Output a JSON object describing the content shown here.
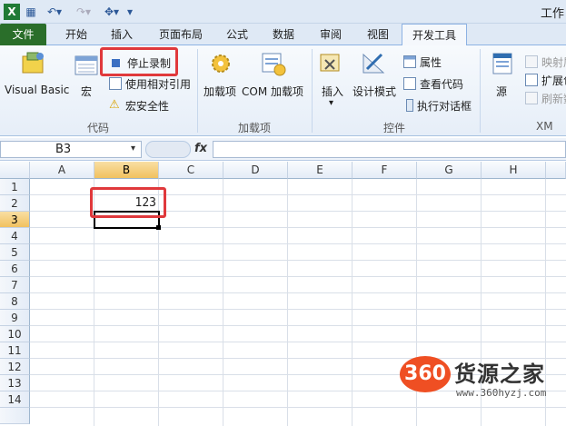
{
  "window": {
    "title": "工作"
  },
  "tabs": [
    {
      "label": "文件"
    },
    {
      "label": "开始"
    },
    {
      "label": "插入"
    },
    {
      "label": "页面布局"
    },
    {
      "label": "公式"
    },
    {
      "label": "数据"
    },
    {
      "label": "审阅"
    },
    {
      "label": "视图"
    },
    {
      "label": "开发工具"
    }
  ],
  "ribbon": {
    "code": {
      "label": "代码",
      "visual_basic": "Visual Basic",
      "macros": "宏",
      "stop_recording": "停止录制",
      "relative_refs": "使用相对引用",
      "macro_security": "宏安全性"
    },
    "addins": {
      "label": "加载项",
      "addins": "加载项",
      "com_addins": "COM 加载项"
    },
    "controls": {
      "label": "控件",
      "insert": "插入",
      "design_mode": "设计模式",
      "properties": "属性",
      "view_code": "查看代码",
      "run_dialog": "执行对话框"
    },
    "xml": {
      "label": "XM",
      "source": "源",
      "map_props": "映射属",
      "expansion": "扩展包",
      "refresh": "刷新数"
    }
  },
  "formula_bar": {
    "name_box": "B3",
    "fx": "fx",
    "content": ""
  },
  "sheet": {
    "columns": [
      "A",
      "B",
      "C",
      "D",
      "E",
      "F",
      "G",
      "H"
    ],
    "rows": [
      "1",
      "2",
      "3",
      "4",
      "5",
      "6",
      "7",
      "8",
      "9",
      "10",
      "11",
      "12",
      "13",
      "14"
    ],
    "selected_column": "B",
    "selected_row": "3",
    "active_cell": "B3",
    "cells": {
      "B2": "123"
    }
  },
  "watermark": {
    "badge": "360",
    "name": "货源之家",
    "url": "www.360hyzj.com"
  }
}
